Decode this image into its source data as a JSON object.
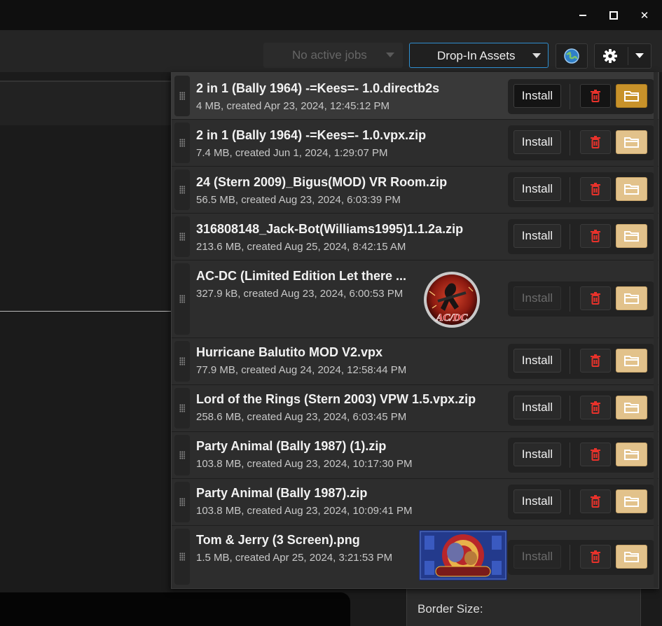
{
  "window": {
    "minimize_glyph": "—",
    "maximize_glyph": "☐",
    "close_glyph": "✕"
  },
  "toolbar": {
    "jobs_label": "No active jobs",
    "assets_label": "Drop-In Assets",
    "globe_icon": "globe-icon",
    "settings_icon": "gear-icon"
  },
  "colors": {
    "accent": "#2f8fd0",
    "folder": "#e2c28b",
    "folder_active": "#c8922a",
    "delete": "#e8322b"
  },
  "list": {
    "install_label": "Install",
    "items": [
      {
        "name": "2 in 1 (Bally 1964) -=Kees=- 1.0.directb2s",
        "meta": "4 MB, created Apr 23, 2024, 12:45:12 PM"
      },
      {
        "name": "2 in 1 (Bally 1964) -=Kees=- 1.0.vpx.zip",
        "meta": "7.4 MB, created Jun 1, 2024, 1:29:07 PM"
      },
      {
        "name": "24 (Stern 2009)_Bigus(MOD) VR Room.zip",
        "meta": "56.5 MB, created Aug 23, 2024, 6:03:39 PM"
      },
      {
        "name": "316808148_Jack-Bot(Williams1995)1.1.2a.zip",
        "meta": "213.6 MB, created Aug 25, 2024, 8:42:15 AM"
      },
      {
        "name": "AC-DC (Limited Edition Let there ...",
        "meta": "327.9 kB, created Aug 23, 2024, 6:00:53 PM",
        "logo_text": "AC/DC"
      },
      {
        "name": "Hurricane Balutito MOD V2.vpx",
        "meta": "77.9 MB, created Aug 24, 2024, 12:58:44 PM"
      },
      {
        "name": "Lord of the Rings (Stern 2003) VPW 1.5.vpx.zip",
        "meta": "258.6 MB, created Aug 23, 2024, 6:03:45 PM"
      },
      {
        "name": "Party Animal (Bally 1987) (1).zip",
        "meta": "103.8 MB, created Aug 23, 2024, 10:17:30 PM"
      },
      {
        "name": "Party Animal (Bally 1987).zip",
        "meta": "103.8 MB, created Aug 23, 2024, 10:09:41 PM"
      },
      {
        "name": "Tom & Jerry (3 Screen).png",
        "meta": "1.5 MB, created Apr 25, 2024, 3:21:53 PM"
      }
    ]
  },
  "side_panel": {
    "border_size_label": "Border Size:"
  }
}
